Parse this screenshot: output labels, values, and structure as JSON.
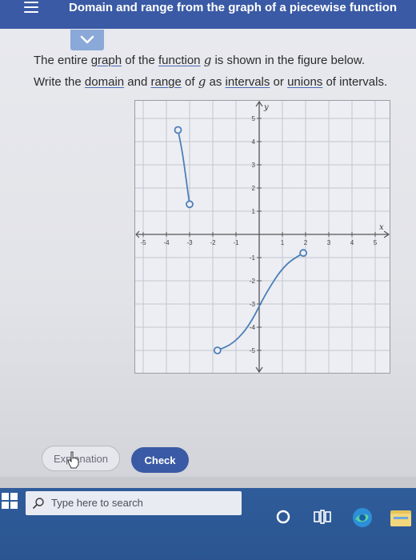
{
  "header": {
    "title": "Domain and range from the graph of a piecewise function"
  },
  "question": {
    "line1": {
      "t1": "The entire ",
      "graph": "graph",
      "t2": " of the ",
      "function": "function",
      "t3": " ",
      "g": "g",
      "t4": " is shown in the figure below."
    },
    "line2": {
      "t1": "Write the ",
      "domain": "domain",
      "t2": " and ",
      "range": "range",
      "t3": " of ",
      "g": "g",
      "t4": " as ",
      "intervals": "intervals",
      "t5": " or ",
      "unions": "unions",
      "t6": " of intervals."
    }
  },
  "graph": {
    "x_axis_label": "x",
    "y_axis_label": "y",
    "x_ticks": [
      "-5",
      "-4",
      "-3",
      "-2",
      "-1",
      "1",
      "2",
      "3",
      "4",
      "5"
    ],
    "y_ticks": [
      "5",
      "4",
      "3",
      "2",
      "1",
      "-1",
      "-2",
      "-3",
      "-4",
      "-5"
    ],
    "segments": [
      {
        "name": "upper-left-piece",
        "points": [
          [
            -3.5,
            4.5
          ],
          [
            -3.3,
            3.5
          ],
          [
            -3.1,
            2.0
          ],
          [
            -3,
            1.3
          ]
        ],
        "start": {
          "x": -3.5,
          "y": 4.5,
          "closed": false
        },
        "end": {
          "x": -3,
          "y": 1.3,
          "closed": false
        }
      },
      {
        "name": "lower-right-piece",
        "points": [
          [
            -1.8,
            -5
          ],
          [
            -1.1,
            -4.7
          ],
          [
            -0.4,
            -3.9
          ],
          [
            0.3,
            -2.5
          ],
          [
            1.1,
            -1.3
          ],
          [
            1.9,
            -0.8
          ]
        ],
        "start": {
          "x": -1.8,
          "y": -5,
          "closed": false
        },
        "end": {
          "x": 1.9,
          "y": -0.8,
          "closed": false
        }
      }
    ],
    "colors": {
      "curve": "#4d7fb8",
      "grid": "#c5c7cf",
      "axis": "#555555"
    }
  },
  "buttons": {
    "explanation": "Explanation",
    "check": "Check"
  },
  "taskbar": {
    "search_placeholder": "Type here to search"
  }
}
